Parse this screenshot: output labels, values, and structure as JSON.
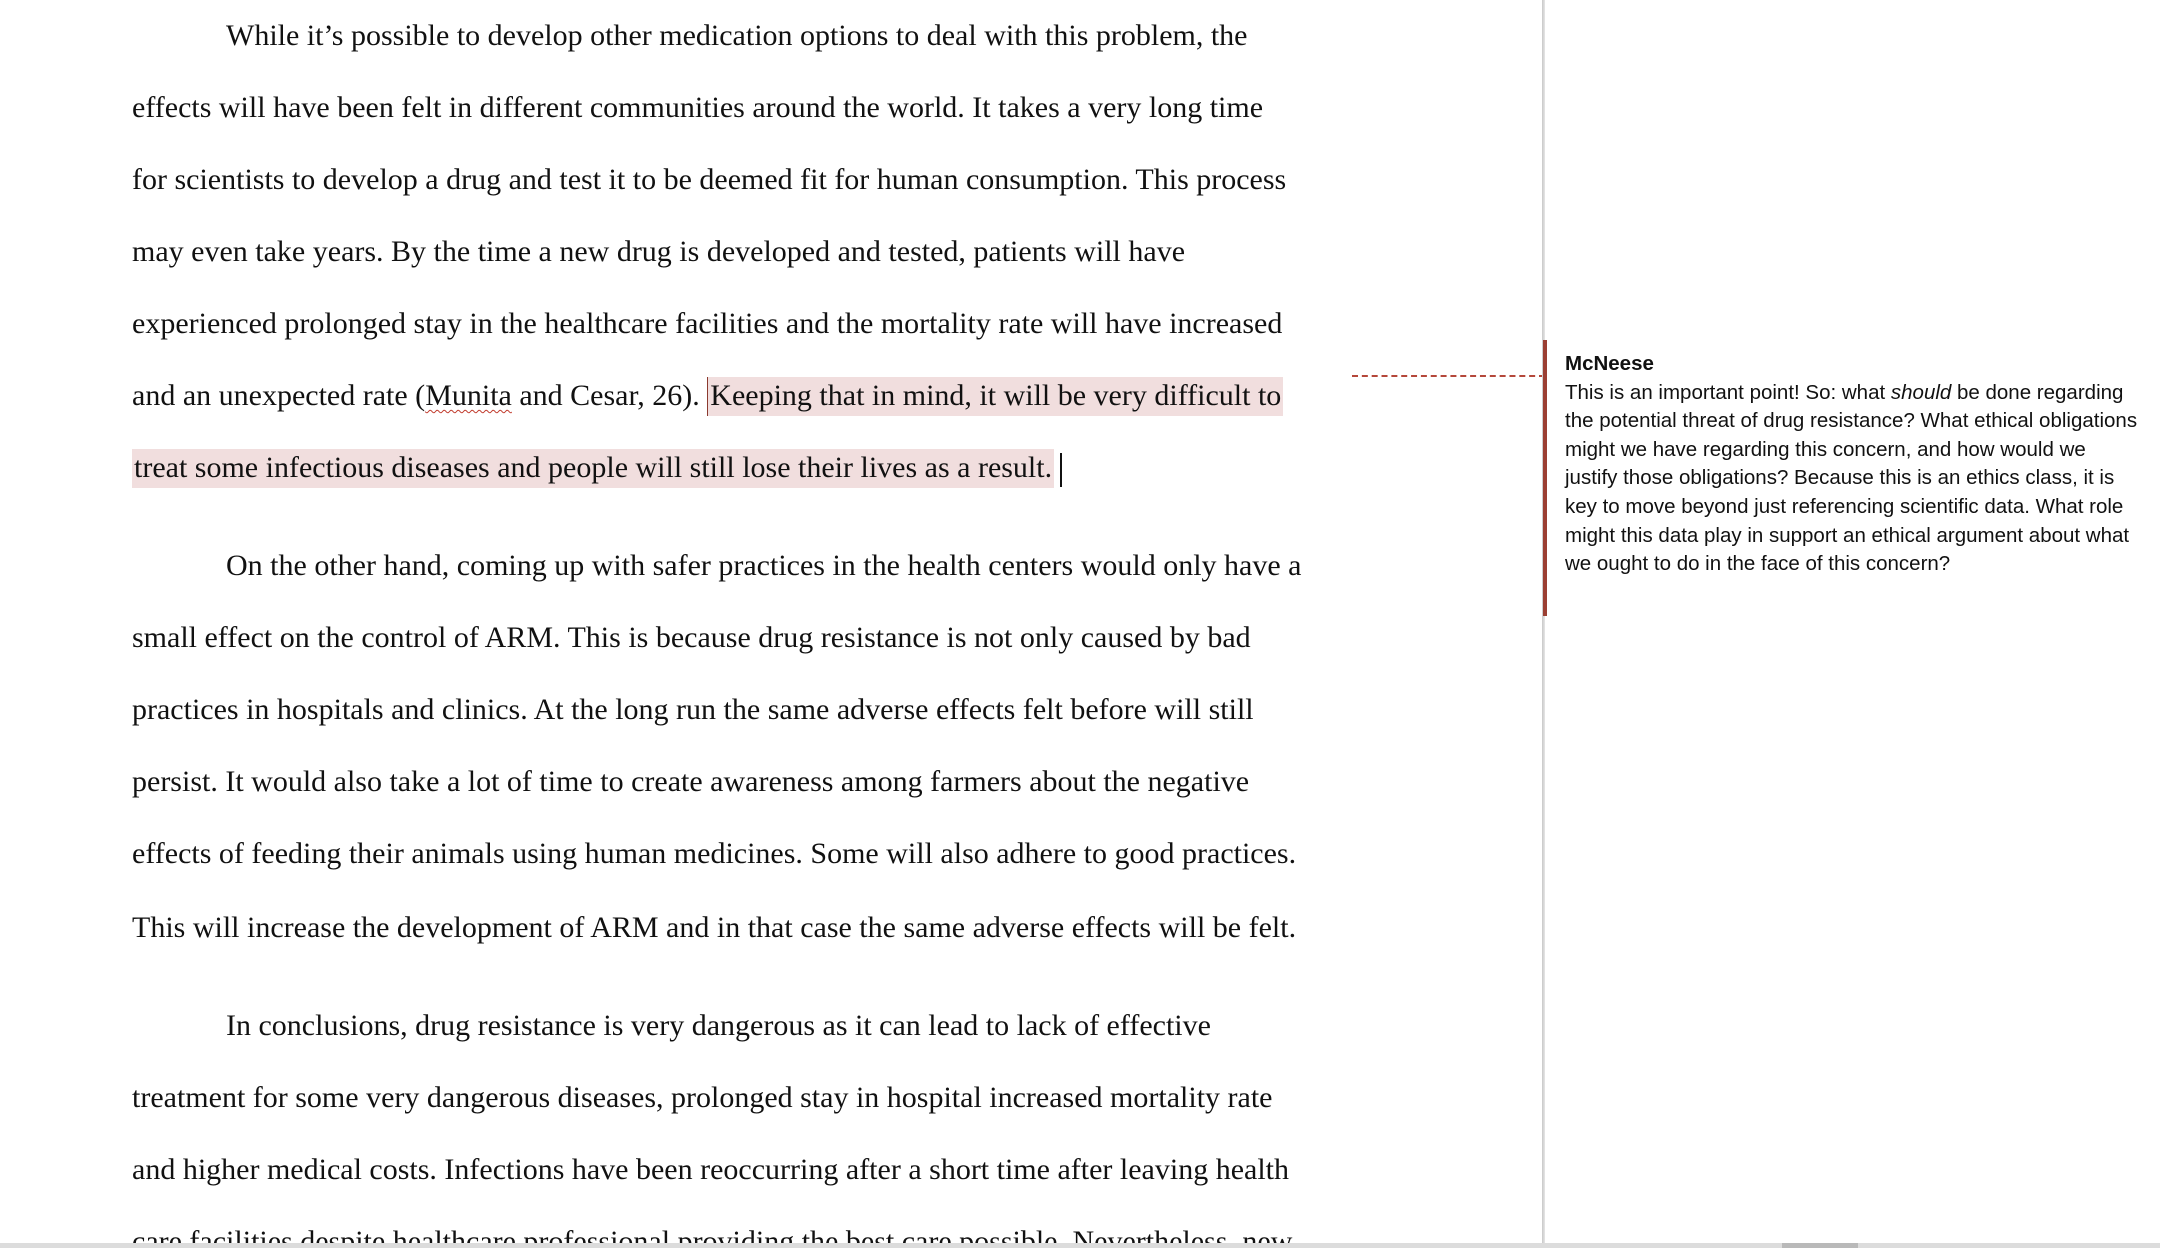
{
  "document": {
    "paragraphs": [
      {
        "lines": [
          "While it’s possible to develop other medication options to deal with this problem, the",
          "effects will have been felt in different communities around the world. It takes a very long time",
          "for scientists to develop a drug and test it to be deemed fit for human consumption. This process",
          "may even take years. By the time a new drug is developed and tested, patients will have",
          "experienced prolonged stay in the healthcare facilities and the mortality rate will have increased"
        ],
        "line6": {
          "before": "and an unexpected rate (",
          "squiggle": "Munita",
          "after": " and Cesar, 26). ",
          "highlight": "Keeping that in mind, it will be very difficult to "
        },
        "line7_highlight": "treat some infectious diseases and people will still lose their lives as a result."
      },
      {
        "lines": [
          "On the other hand, coming up with safer practices in the health centers would only have a",
          "small effect on the control of ARM. This is because drug resistance is not only caused by bad",
          "practices in hospitals and clinics. At the long run the same adverse effects felt before will still",
          "persist. It would also take a lot of time to create awareness among farmers about the negative",
          "effects of feeding their animals using human medicines. Some will also adhere to good practices.",
          "This will increase the development of ARM and in that case the same adverse effects will be felt."
        ]
      },
      {
        "lines": [
          "In conclusions, drug resistance is very dangerous as it can lead to lack of effective",
          "treatment for some very dangerous diseases, prolonged stay in hospital increased mortality rate",
          "and higher medical costs. Infections have been reoccurring after a short time after leaving health",
          "care facilities despite healthcare professional providing the best care possible. Nevertheless, new"
        ]
      }
    ]
  },
  "comment": {
    "author": "McNeese",
    "body_before_italic": "This is an important point! So: what ",
    "body_italic": "should",
    "body_after_italic": " be done regarding the potential threat of drug resistance? What ethical obligations might we have regarding this concern, and how would we justify those obligations? Because this is an ethics class, it is key to move beyond just referencing scientific data. What role might this data play in support an ethical argument about what we ought to do in the face of this concern?"
  },
  "colors": {
    "comment_accent": "#9b3f33",
    "highlight": "#f1dede",
    "text": "#111111"
  }
}
